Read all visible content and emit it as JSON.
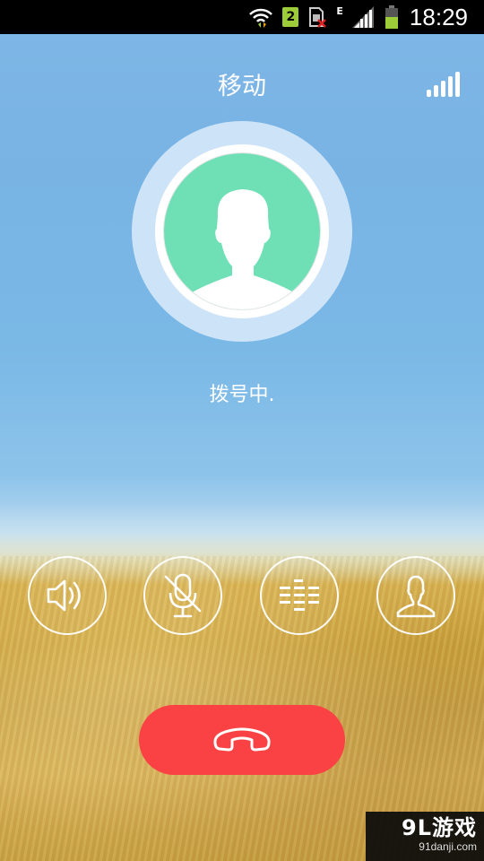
{
  "status_bar": {
    "sim_badge": "2",
    "network_type": "E",
    "time": "18:29",
    "icons": [
      "wifi-icon",
      "sim2-icon",
      "no-sim-icon",
      "cellular-signal-icon",
      "battery-icon"
    ],
    "battery_color": "#9ccd38"
  },
  "call": {
    "carrier": "移动",
    "status": "拨号中.",
    "avatar_color": "#6fe0b6"
  },
  "controls": [
    {
      "name": "speaker",
      "icon": "speaker-icon"
    },
    {
      "name": "mute",
      "icon": "mic-muted-icon"
    },
    {
      "name": "keypad",
      "icon": "keypad-icon"
    },
    {
      "name": "contacts",
      "icon": "contact-icon"
    }
  ],
  "hangup": {
    "icon": "phone-hangup-icon",
    "color": "#fa4244"
  },
  "watermark": {
    "logo": "9L游戏",
    "url": "91danji.com"
  }
}
